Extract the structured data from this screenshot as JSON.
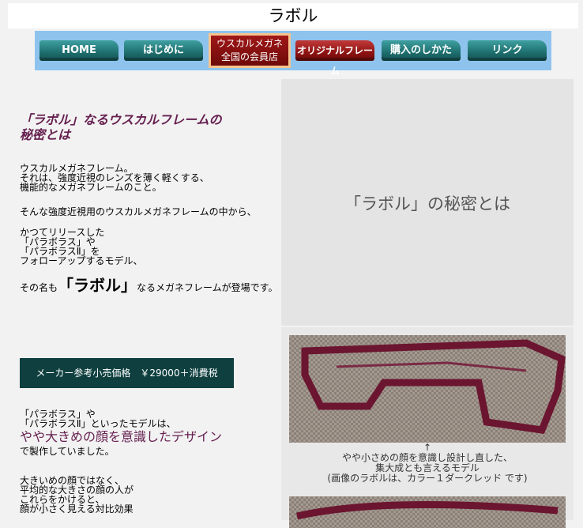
{
  "title": "ラボル",
  "nav": {
    "items": [
      "HOME",
      "はじめに",
      "オリジナルフレーム",
      "購入のしかた",
      "リンク"
    ],
    "active_line1": "ウスカルメガネ",
    "active_line2": "全国の会員店"
  },
  "left": {
    "heading_line1": "「ラボル」なるウスカルフレームの",
    "heading_line2": "秘密とは",
    "p1": "ウスカルメガネフレーム。\nそれは、強度近視のレンズを薄く軽くする、\n機能的なメガネフレームのこと。",
    "p2": "そんな強度近視用のウスカルメガネフレームの中から、",
    "p3": "かつてリリースした\n「パラボラス」や\n「パラボラスⅡ」を\nフォローアップするモデル、",
    "p4_pre": "その名も",
    "p4_big": "「ラボル」",
    "p4_post": "なるメガネフレームが登場です。",
    "price": "メーカー参考小売価格　￥29000＋消費税",
    "p5": "「パラボラス」や\n「パラボラスⅡ」といったモデルは、",
    "p5_purple": "やや大きめの顔を意識したデザイン",
    "p5_end": "で製作していました。",
    "p6": "大きいめの顔ではなく、\n平均的な大きさの顔の人が\nこれらをかけると、\n顔が小さく見える対比効果"
  },
  "right": {
    "title": "「ラボル」の秘密とは",
    "arrow": "↑",
    "caption": "やや小さめの顔を意識し設計し直した、\n集大成とも言えるモデル\n(画像のラボルは、カラー１ダークレッド です)"
  },
  "colors": {
    "nav_bg": "#8ec3ee",
    "heading": "#662050",
    "price_bg": "#0f3f3f"
  }
}
